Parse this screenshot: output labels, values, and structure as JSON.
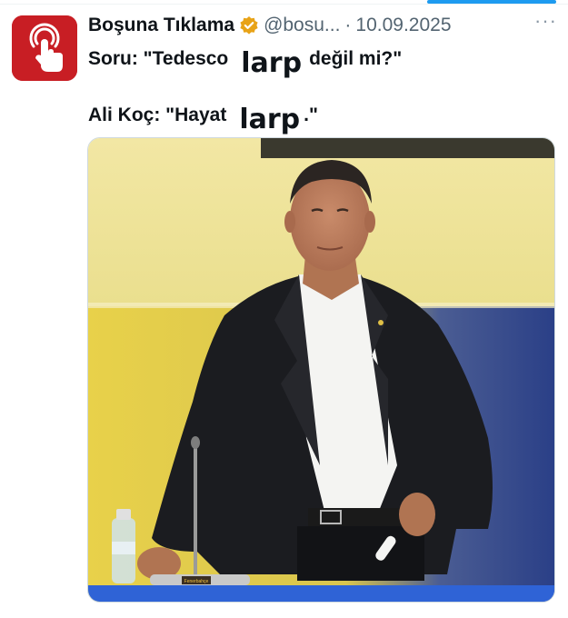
{
  "tweet": {
    "author_name": "Boşuna Tıklama",
    "handle": "@bosu...",
    "separator": "·",
    "date": "10.09.2025",
    "more_label": "···",
    "line1_before": "Soru: \"Tedesco",
    "line1_sticker": "larp",
    "line1_after": "değil mi?\"",
    "line2_before": "Ali Koç: \"Hayat",
    "line2_sticker": "larp",
    "line2_after": ".\""
  },
  "media": {
    "stand_plate_text": "Fenerbahçe"
  },
  "colors": {
    "accent": "#1d9bf0",
    "avatar_bg": "#c81e24",
    "verified_badge": "#e8a317",
    "secondary_text": "#536471"
  },
  "icons": {
    "avatar": "tap-hand-icon",
    "verified": "verified-badge-icon"
  }
}
